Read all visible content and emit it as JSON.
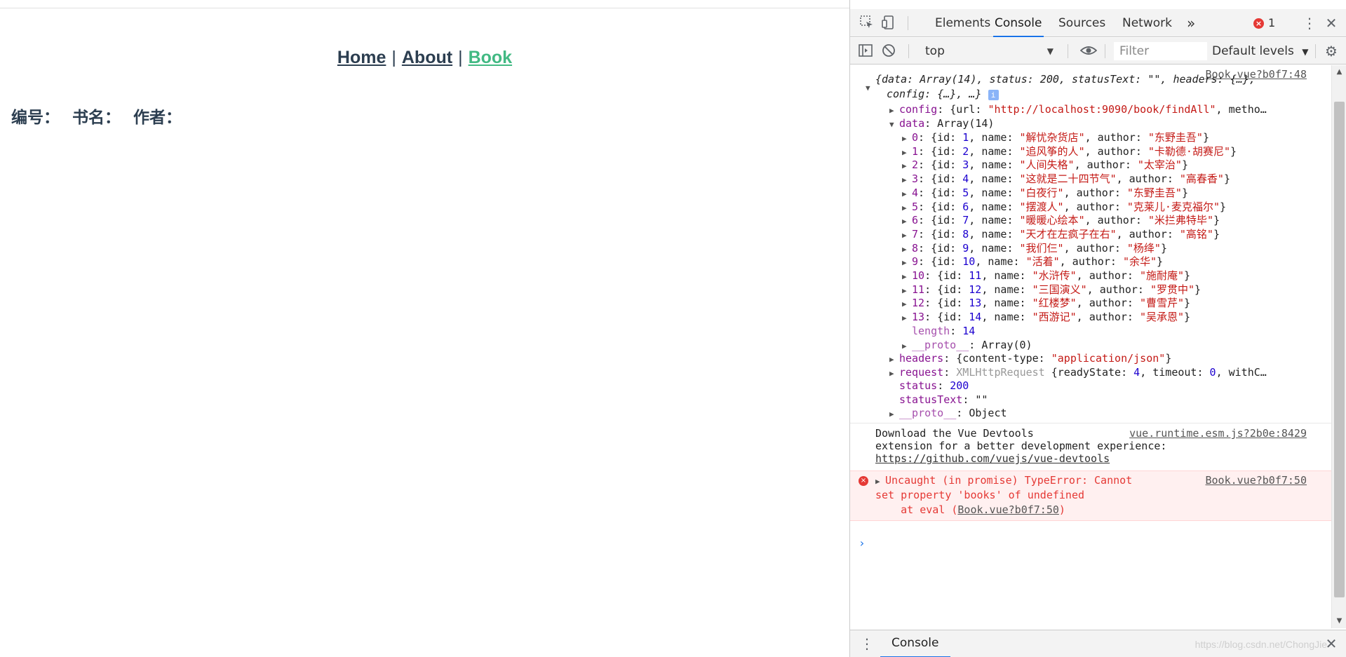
{
  "page": {
    "nav": {
      "home": "Home",
      "about": "About",
      "book": "Book",
      "sep": "|"
    },
    "table_header": {
      "id": "编号：",
      "name": "书名：",
      "author": "作者："
    },
    "colors": {
      "text": "#2c3e50",
      "active": "#42b983"
    }
  },
  "devtools": {
    "tabs": [
      "Elements",
      "Console",
      "Sources",
      "Network"
    ],
    "more": "»",
    "error_count": "1",
    "toolbar": {
      "context": "top",
      "filter_placeholder": "Filter",
      "levels": "Default levels"
    },
    "console": {
      "src1": "Book.vue?b0f7:48",
      "obj_summary_1": "{data: Array(14), status: 200, statusText: \"\", headers: {…},",
      "obj_summary_2": "config: {…}, …}",
      "config_key": "config",
      "config_val_pre": ": {url: ",
      "config_url": "\"http://localhost:9090/book/findAll\"",
      "config_val_post": ", metho…",
      "data_key": "data",
      "data_val": ": Array(14)",
      "items": [
        {
          "idx": "0",
          "id": "1",
          "name": "\"解忧杂货店\"",
          "author": "\"东野圭吾\""
        },
        {
          "idx": "1",
          "id": "2",
          "name": "\"追风筝的人\"",
          "author": "\"卡勒德·胡赛尼\""
        },
        {
          "idx": "2",
          "id": "3",
          "name": "\"人间失格\"",
          "author": "\"太宰治\""
        },
        {
          "idx": "3",
          "id": "4",
          "name": "\"这就是二十四节气\"",
          "author": "\"高春香\""
        },
        {
          "idx": "4",
          "id": "5",
          "name": "\"白夜行\"",
          "author": "\"东野圭吾\""
        },
        {
          "idx": "5",
          "id": "6",
          "name": "\"摆渡人\"",
          "author": "\"克莱儿·麦克福尔\""
        },
        {
          "idx": "6",
          "id": "7",
          "name": "\"暖暖心绘本\"",
          "author": "\"米拦弗特毕\""
        },
        {
          "idx": "7",
          "id": "8",
          "name": "\"天才在左疯子在右\"",
          "author": "\"高铭\""
        },
        {
          "idx": "8",
          "id": "9",
          "name": "\"我们仨\"",
          "author": "\"杨绛\""
        },
        {
          "idx": "9",
          "id": "10",
          "name": "\"活着\"",
          "author": "\"余华\""
        },
        {
          "idx": "10",
          "id": "11",
          "name": "\"水浒传\"",
          "author": "\"施耐庵\""
        },
        {
          "idx": "11",
          "id": "12",
          "name": "\"三国演义\"",
          "author": "\"罗贯中\""
        },
        {
          "idx": "12",
          "id": "13",
          "name": "\"红楼梦\"",
          "author": "\"曹雪芹\""
        },
        {
          "idx": "13",
          "id": "14",
          "name": "\"西游记\"",
          "author": "\"吴承恩\""
        }
      ],
      "length_key": "length",
      "length_val": "14",
      "proto_key": "__proto__",
      "proto_array": ": Array(0)",
      "headers_key": "headers",
      "headers_pre": ": {content-type: ",
      "headers_val": "\"application/json\"",
      "headers_post": "}",
      "request_key": "request",
      "request_type": "XMLHttpRequest",
      "request_pre": " {readyState: ",
      "request_rs": "4",
      "request_mid": ", timeout: ",
      "request_to": "0",
      "request_post": ", withC…",
      "status_key": "status",
      "status_val": "200",
      "statustext_key": "statusText",
      "statustext_val": "\"\"",
      "proto_object": ": Object",
      "vue_msg_1": "Download the Vue Devtools",
      "vue_src": "vue.runtime.esm.js?2b0e:8429",
      "vue_msg_2": "extension for a better development experience:",
      "vue_link": "https://github.com/vuejs/vue-devtools",
      "err_1": "Uncaught (in promise) TypeError: Cannot",
      "err_src": "Book.vue?b0f7:50",
      "err_2": "set property 'books' of undefined",
      "err_3_pre": "    at eval (",
      "err_3_link": "Book.vue?b0f7:50",
      "err_3_post": ")"
    },
    "drawer": {
      "tab": "Console",
      "watermark": "https://blog.csdn.net/ChongJie"
    }
  }
}
